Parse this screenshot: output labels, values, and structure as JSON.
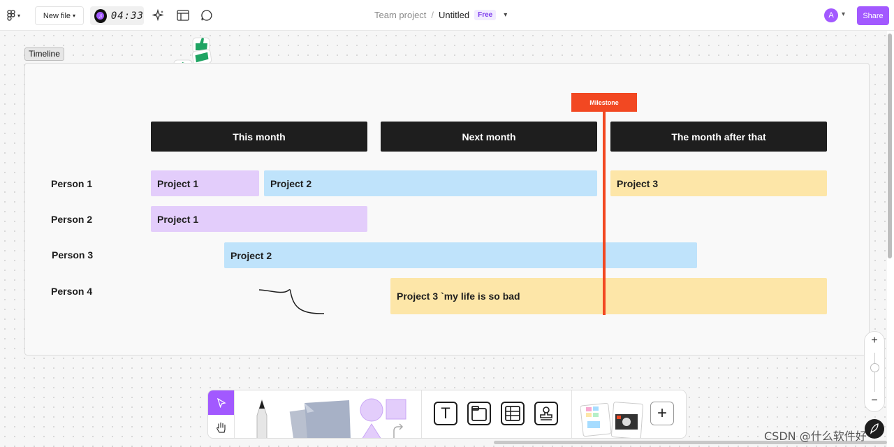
{
  "topbar": {
    "new_file_label": "New file",
    "timer": "04:33",
    "breadcrumb_team": "Team project",
    "breadcrumb_sep": "/",
    "file_title": "Untitled",
    "plan_badge": "Free",
    "avatar_initial": "A",
    "share_label": "Share",
    "icons": [
      "figjam-logo-icon",
      "music-disc-icon",
      "sparkle-ai-icon",
      "layout-icon",
      "comment-icon"
    ]
  },
  "section": {
    "label": "Timeline",
    "headers": [
      "This month",
      "Next month",
      "The month after that"
    ],
    "milestone": "Milestone",
    "people": [
      "Person 1",
      "Person 2",
      "Person 3",
      "Person 4"
    ],
    "bars": [
      {
        "person": "Person 1",
        "label": "Project 1",
        "color": "#e3cdfb"
      },
      {
        "person": "Person 1",
        "label": "Project 2",
        "color": "#bfe3fb"
      },
      {
        "person": "Person 1",
        "label": "Project 3",
        "color": "#fde6a8"
      },
      {
        "person": "Person 2",
        "label": "Project 1",
        "color": "#e3cdfb"
      },
      {
        "person": "Person 3",
        "label": "Project 2",
        "color": "#bfe3fb"
      },
      {
        "person": "Person 4",
        "label": "Project 3  `my life is so bad",
        "color": "#fde6a8"
      }
    ]
  },
  "colors": {
    "accent": "#a259ff",
    "milestone": "#f24822",
    "header_bg": "#1e1e1e",
    "sticker": "#1fa463"
  },
  "zoom": {
    "plus": "+",
    "minus": "−"
  },
  "toolbar": {
    "tools": [
      "select-tool",
      "hand-tool",
      "marker-tool",
      "sticky-note-tool",
      "shape-tool",
      "text-tool",
      "section-tool",
      "table-tool",
      "stamp-tool",
      "templates-tool",
      "more-tool"
    ],
    "text_tool_glyph": "T",
    "more_glyph": "+"
  },
  "watermark": "CSDN @什么软件好"
}
